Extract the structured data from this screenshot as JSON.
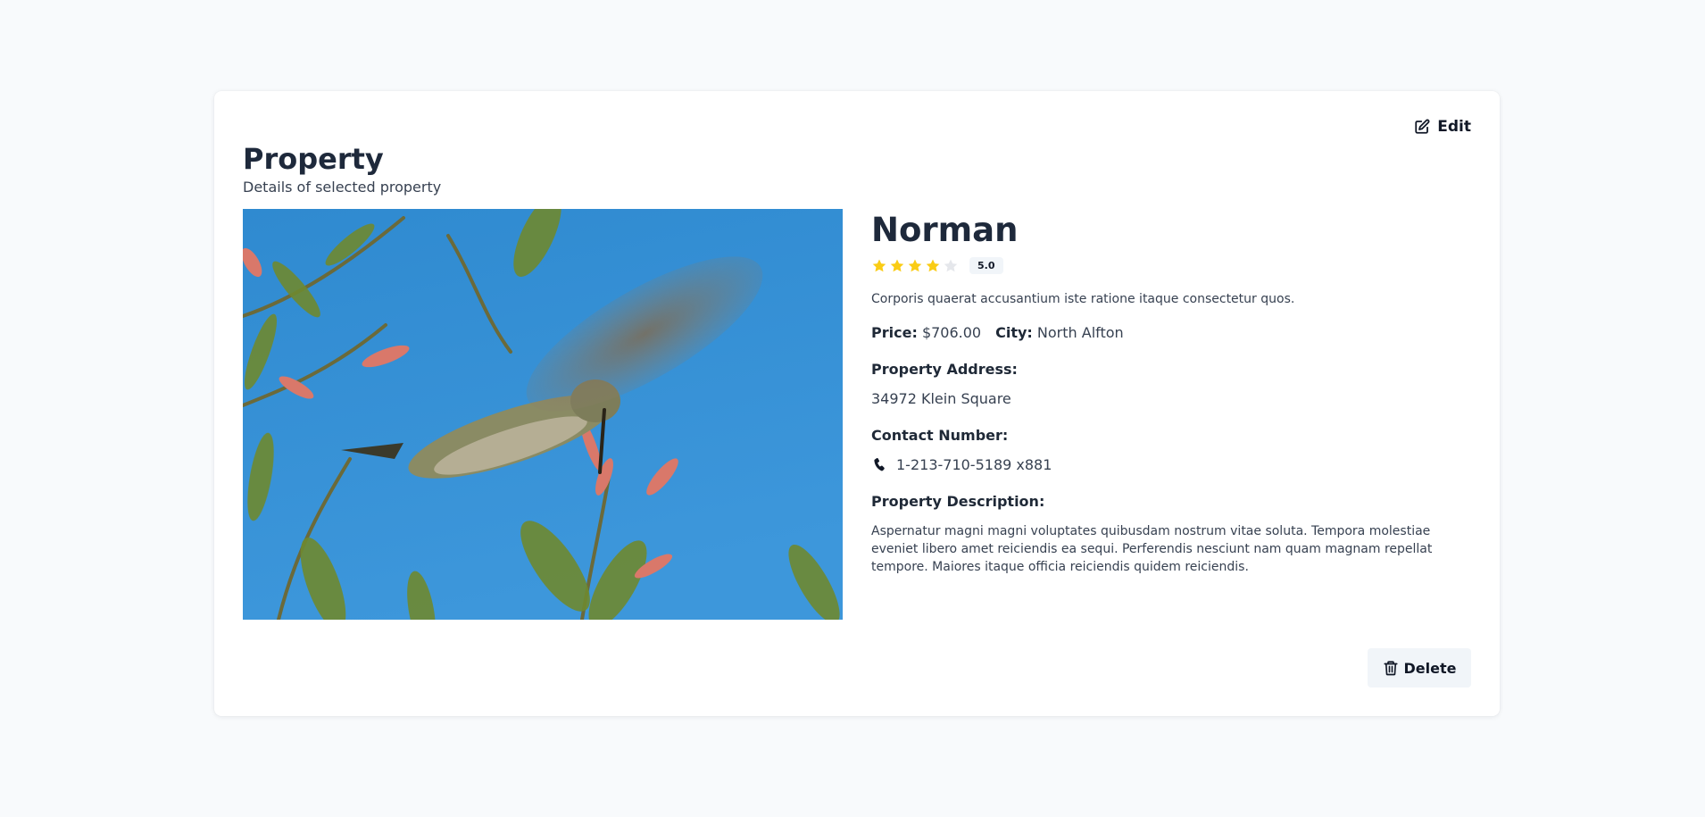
{
  "header": {
    "title": "Property",
    "subtitle": "Details of selected property",
    "edit_label": "Edit"
  },
  "property": {
    "name": "Norman",
    "rating": 4,
    "rating_max": 5,
    "rating_badge": "5.0",
    "short_description": "Corporis quaerat accusantium iste ratione itaque consectetur quos.",
    "price_label": "Price:",
    "price_value": "$706.00",
    "city_label": "City:",
    "city_value": "North Alfton",
    "address_label": "Property Address:",
    "address_value": "34972 Klein Square",
    "contact_label": "Contact Number:",
    "contact_value": "1-213-710-5189 x881",
    "description_label": "Property Description:",
    "description_value": "Aspernatur magni magni voluptates quibusdam nostrum vitae soluta. Tempora molestiae eveniet libero amet reiciendis ea sequi. Perferendis nesciunt nam quam magnam repellat tempore. Maiores itaque officia reiciendis quidem reiciendis."
  },
  "actions": {
    "delete_label": "Delete"
  },
  "colors": {
    "star_filled": "#facc15",
    "star_empty": "#e5e7eb",
    "sky": "#3b8fd6"
  },
  "icons": {
    "edit": "edit-icon",
    "phone": "phone-icon",
    "delete": "trash-icon",
    "star": "star-icon"
  }
}
